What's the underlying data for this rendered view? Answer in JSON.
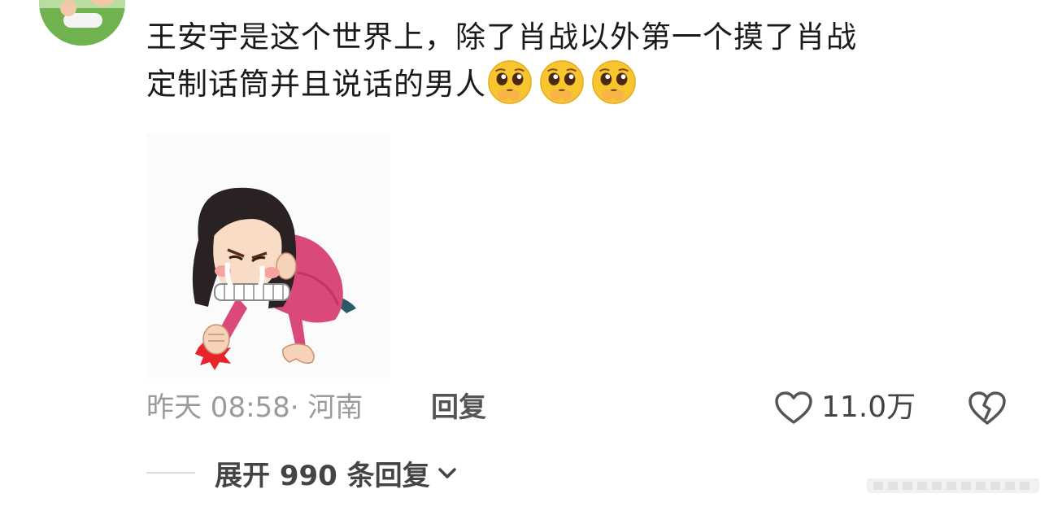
{
  "comment": {
    "line1": "王安宇是这个世界上，除了肖战以外第一个摸了肖战",
    "line2": "定制话筒并且说话的男人",
    "emojis": [
      "pleading-face-emoji",
      "pleading-face-emoji",
      "pleading-face-emoji"
    ]
  },
  "sticker": {
    "icon": "frustrated-girl-pounding-floor-sticker"
  },
  "meta": {
    "time_location": "昨天 08:58· 河南",
    "reply_label": "回复",
    "like_count": "11.0万"
  },
  "expand": {
    "label": "展开 990 条回复"
  },
  "colors": {
    "text_primary": "#1a1a1a",
    "text_muted": "#9a9a9a",
    "text_secondary": "#555555",
    "emoji_yellow": "#f8c52f"
  }
}
